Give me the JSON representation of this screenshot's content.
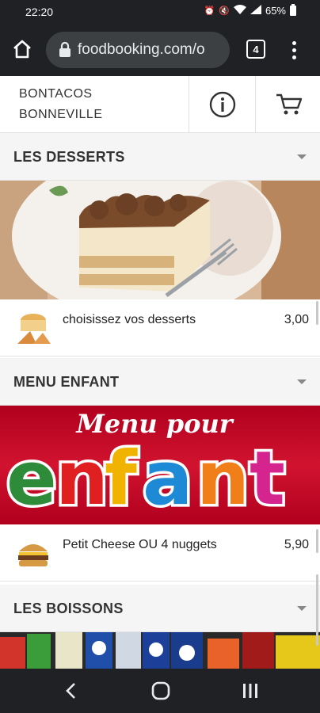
{
  "status_bar": {
    "time": "22:20",
    "battery": "65%",
    "icons": [
      "alarm-icon",
      "mute-icon",
      "wifi-icon",
      "signal-icon",
      "battery-icon"
    ]
  },
  "browser": {
    "url": "foodbooking.com/o",
    "tab_count": "4",
    "icons": [
      "home-icon",
      "lock-icon",
      "tabs-icon",
      "more-vert-icon"
    ]
  },
  "header": {
    "name_line1": "BONTACOS",
    "name_line2": "BONNEVILLE",
    "icons": [
      "info-icon",
      "cart-icon"
    ]
  },
  "sections": [
    {
      "title": "LES DESSERTS",
      "items": [
        {
          "name": "choisissez vos desserts",
          "price": "3,00"
        }
      ]
    },
    {
      "title": "MENU ENFANT",
      "banner_text_line1": "Menu pour",
      "banner_text_line2": "enfant",
      "items": [
        {
          "name": "Petit Cheese OU 4 nuggets",
          "price": "5,90"
        }
      ]
    },
    {
      "title": "LES BOISSONS",
      "items": []
    }
  ],
  "colors": {
    "chrome_dark": "#202124",
    "url_box": "#3c4043",
    "section_bg": "#f5f5f5",
    "kids_banner_red": "#c8102e"
  },
  "nav": {
    "icons": [
      "back-icon",
      "home-circle-icon",
      "recents-icon"
    ]
  }
}
